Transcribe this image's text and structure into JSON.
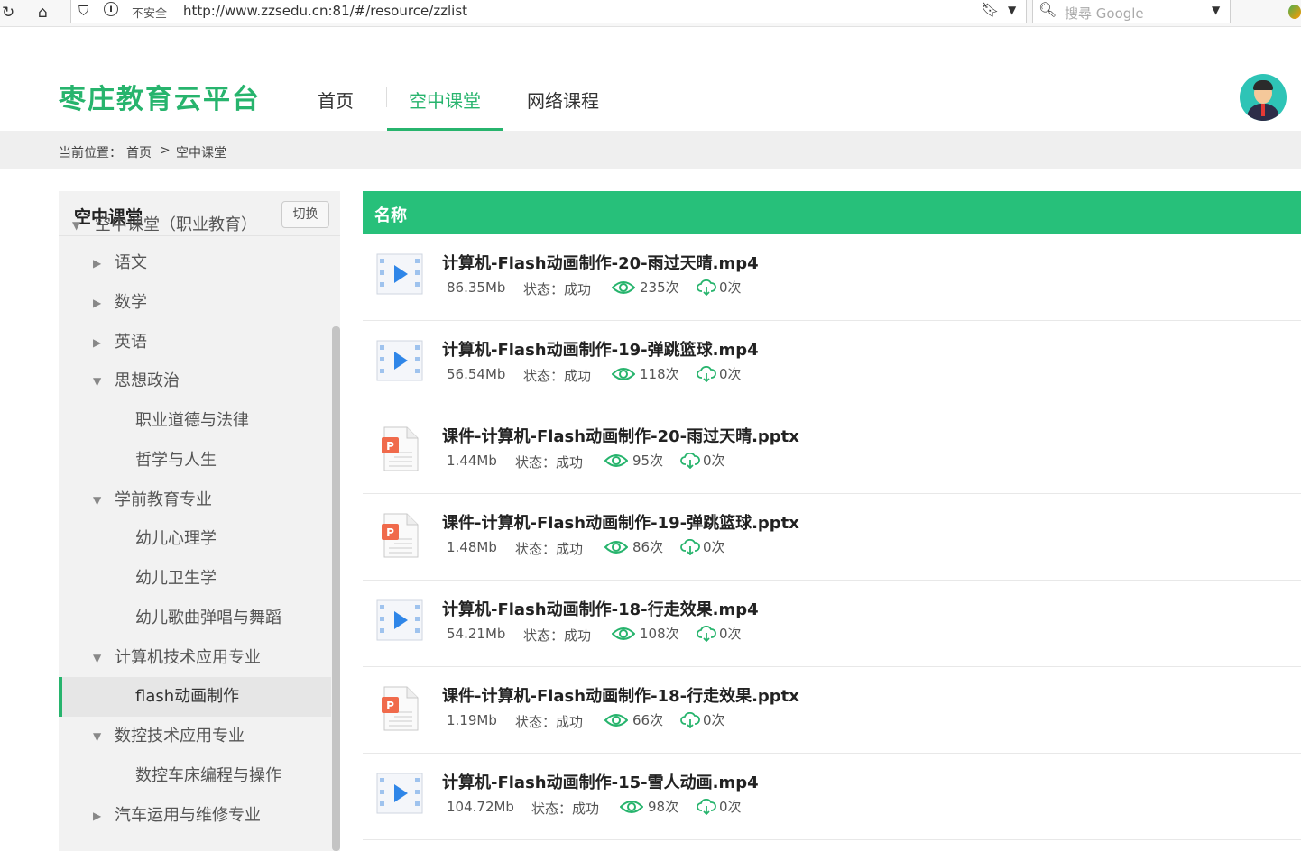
{
  "browser": {
    "security_label": "不安全",
    "url": "http://www.zzsedu.cn:81/#/resource/zzlist",
    "search_placeholder": "搜尋 Google"
  },
  "header": {
    "logo": "枣庄教育云平台",
    "nav": [
      "首页",
      "空中课堂",
      "网络课程"
    ],
    "active_nav": "空中课堂"
  },
  "breadcrumb": {
    "prefix": "当前位置：",
    "home": "首页",
    "separator": ">",
    "current": "空中课堂"
  },
  "sidebar": {
    "title": "空中课堂",
    "switch_label": "切换",
    "tree": [
      {
        "label": "空中课堂（职业教育）",
        "level": 0,
        "state": "expanded"
      },
      {
        "label": "语文",
        "level": 1,
        "state": "collapsed"
      },
      {
        "label": "数学",
        "level": 1,
        "state": "collapsed"
      },
      {
        "label": "英语",
        "level": 1,
        "state": "collapsed"
      },
      {
        "label": "思想政治",
        "level": 1,
        "state": "expanded"
      },
      {
        "label": "职业道德与法律",
        "level": 2,
        "state": "leaf"
      },
      {
        "label": "哲学与人生",
        "level": 2,
        "state": "leaf"
      },
      {
        "label": "学前教育专业",
        "level": 1,
        "state": "expanded"
      },
      {
        "label": "幼儿心理学",
        "level": 2,
        "state": "leaf"
      },
      {
        "label": "幼儿卫生学",
        "level": 2,
        "state": "leaf"
      },
      {
        "label": "幼儿歌曲弹唱与舞蹈",
        "level": 2,
        "state": "leaf"
      },
      {
        "label": "计算机技术应用专业",
        "level": 1,
        "state": "expanded"
      },
      {
        "label": "flash动画制作",
        "level": 2,
        "state": "leaf",
        "selected": true
      },
      {
        "label": "数控技术应用专业",
        "level": 1,
        "state": "expanded"
      },
      {
        "label": "数控车床编程与操作",
        "level": 2,
        "state": "leaf"
      },
      {
        "label": "汽车运用与维修专业",
        "level": 1,
        "state": "collapsed"
      }
    ]
  },
  "list": {
    "column_header": "名称",
    "status_label": "状态：",
    "items": [
      {
        "type": "video",
        "name": "计算机-Flash动画制作-20-雨过天晴.mp4",
        "size": "86.35Mb",
        "status": "成功",
        "views": "235次",
        "downloads": "0次"
      },
      {
        "type": "video",
        "name": "计算机-Flash动画制作-19-弹跳篮球.mp4",
        "size": "56.54Mb",
        "status": "成功",
        "views": "118次",
        "downloads": "0次"
      },
      {
        "type": "ppt",
        "name": "课件-计算机-Flash动画制作-20-雨过天晴.pptx",
        "size": "1.44Mb",
        "status": "成功",
        "views": "95次",
        "downloads": "0次"
      },
      {
        "type": "ppt",
        "name": "课件-计算机-Flash动画制作-19-弹跳篮球.pptx",
        "size": "1.48Mb",
        "status": "成功",
        "views": "86次",
        "downloads": "0次"
      },
      {
        "type": "video",
        "name": "计算机-Flash动画制作-18-行走效果.mp4",
        "size": "54.21Mb",
        "status": "成功",
        "views": "108次",
        "downloads": "0次"
      },
      {
        "type": "ppt",
        "name": "课件-计算机-Flash动画制作-18-行走效果.pptx",
        "size": "1.19Mb",
        "status": "成功",
        "views": "66次",
        "downloads": "0次"
      },
      {
        "type": "video",
        "name": "计算机-Flash动画制作-15-雪人动画.mp4",
        "size": "104.72Mb",
        "status": "成功",
        "views": "98次",
        "downloads": "0次"
      }
    ]
  },
  "colors": {
    "accent": "#27b46d",
    "header_bar": "#27c07a"
  }
}
